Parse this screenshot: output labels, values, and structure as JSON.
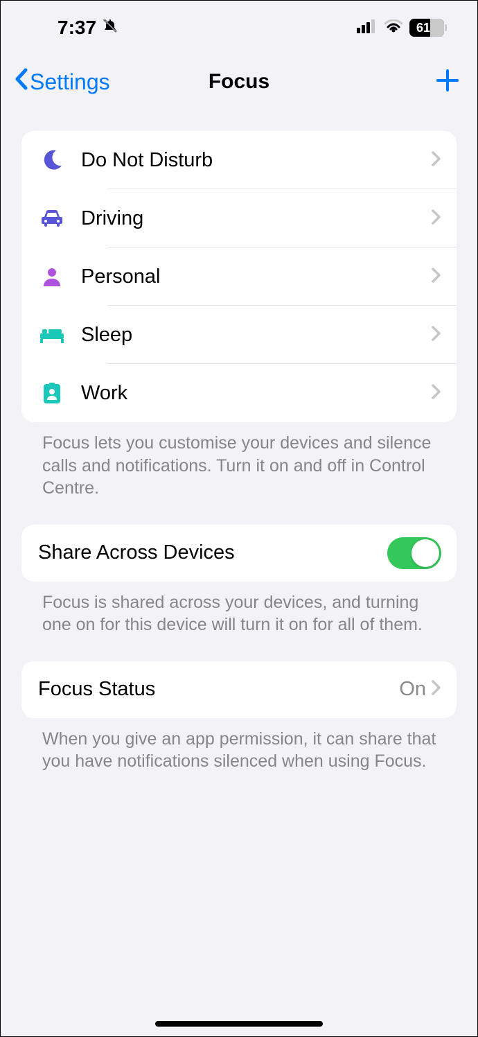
{
  "status_bar": {
    "time": "7:37",
    "battery": "61"
  },
  "nav": {
    "back_label": "Settings",
    "title": "Focus"
  },
  "focus_modes": [
    {
      "label": "Do Not Disturb",
      "icon": "moon",
      "color": "#5856d6"
    },
    {
      "label": "Driving",
      "icon": "car",
      "color": "#5856d6"
    },
    {
      "label": "Personal",
      "icon": "person",
      "color": "#af52de"
    },
    {
      "label": "Sleep",
      "icon": "bed",
      "color": "#1bc7b8"
    },
    {
      "label": "Work",
      "icon": "badge",
      "color": "#1bc7b8"
    }
  ],
  "focus_footer": "Focus lets you customise your devices and silence calls and notifications. Turn it on and off in Control Centre.",
  "share_section": {
    "label": "Share Across Devices",
    "enabled": true,
    "footer": "Focus is shared across your devices, and turning one on for this device will turn it on for all of them."
  },
  "status_section": {
    "label": "Focus Status",
    "value": "On",
    "footer": "When you give an app permission, it can share that you have notifications silenced when using Focus."
  }
}
